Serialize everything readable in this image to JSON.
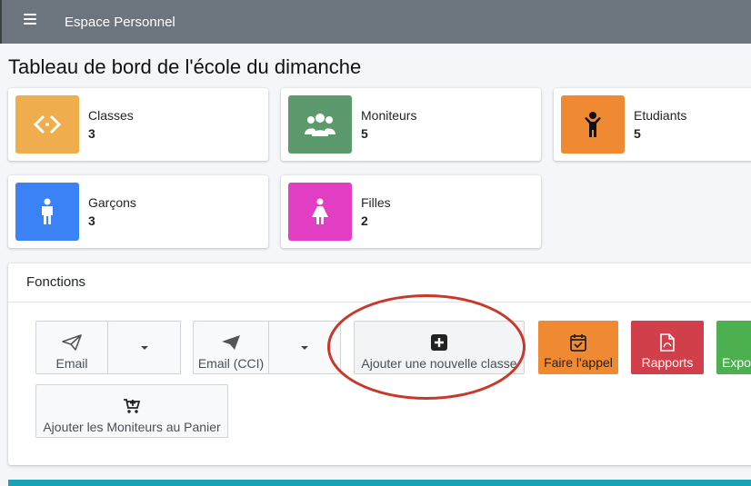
{
  "topbar": {
    "title": "Espace Personnel"
  },
  "page": {
    "title": "Tableau de bord de l'école du dimanche"
  },
  "stats": [
    {
      "label": "Classes",
      "value": "3",
      "color": "#f0ad4e",
      "icon": "code-icon"
    },
    {
      "label": "Moniteurs",
      "value": "5",
      "color": "#5c9a6e",
      "icon": "users-icon"
    },
    {
      "label": "Etudiants",
      "value": "5",
      "color": "#ef8a32",
      "icon": "child-icon"
    },
    {
      "label": "Garçons",
      "value": "3",
      "color": "#3b82f6",
      "icon": "male-icon"
    },
    {
      "label": "Filles",
      "value": "2",
      "color": "#e23ec3",
      "icon": "female-icon"
    }
  ],
  "fonctions": {
    "title": "Fonctions",
    "buttons": {
      "email": "Email",
      "email_cci": "Email (CCI)",
      "add_class": "Ajouter une nouvelle classe",
      "attendance": "Faire l'appel",
      "reports": "Rapports",
      "export": "Export",
      "add_monitors_cart": "Ajouter les Moniteurs au Panier"
    }
  },
  "colors": {
    "attendance": "#ef8a32",
    "reports": "#d1404a",
    "export": "#4caf50",
    "annotation": "#c9382a"
  }
}
